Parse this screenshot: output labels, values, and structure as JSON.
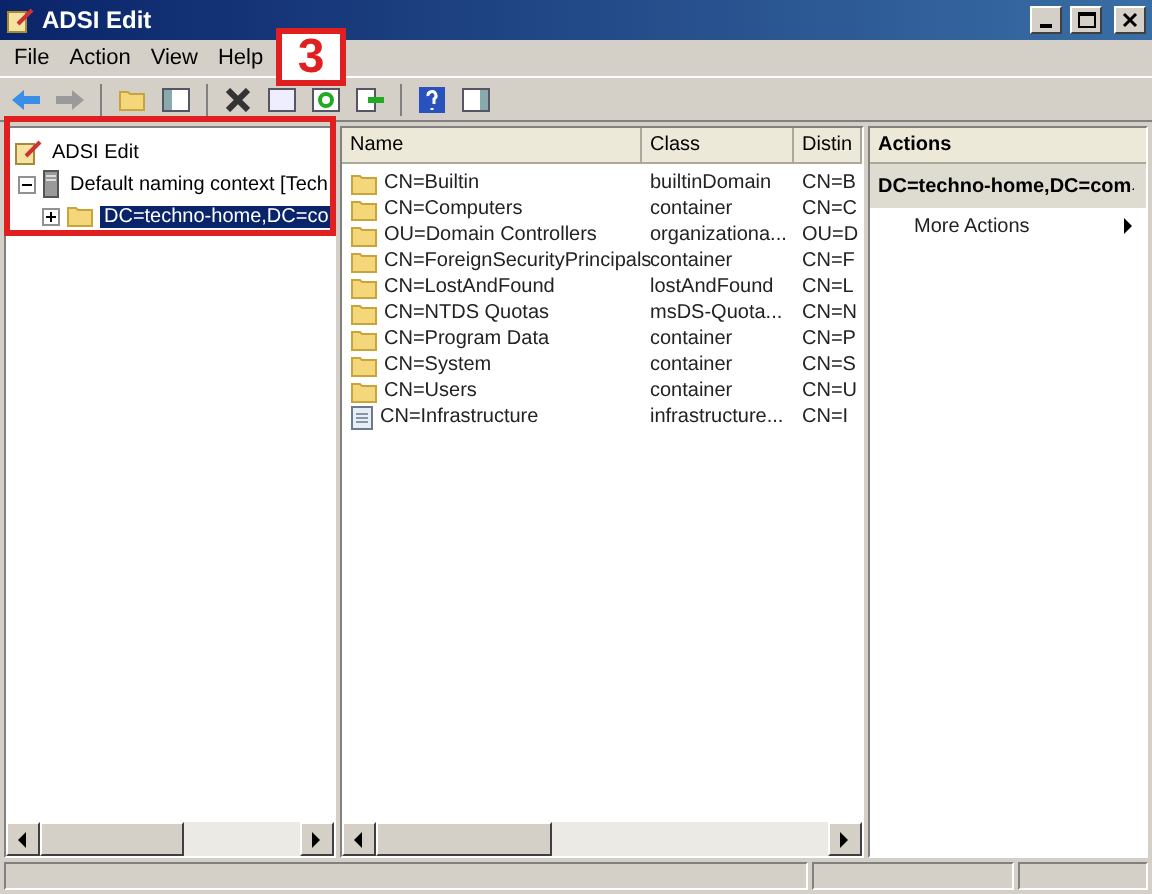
{
  "window": {
    "title": "ADSI Edit"
  },
  "menu": [
    "File",
    "Action",
    "View",
    "Help"
  ],
  "tree": [
    {
      "label": "ADSI Edit",
      "kind": "root",
      "selected": false,
      "children": [
        {
          "label": "Default naming context [Tech",
          "kind": "server",
          "expanded": true,
          "selected": false,
          "children": [
            {
              "label": "DC=techno-home,DC=co",
              "kind": "folder",
              "expanded": false,
              "selected": true
            }
          ]
        }
      ]
    }
  ],
  "annotation": {
    "label": "3"
  },
  "list": {
    "columns": [
      "Name",
      "Class",
      "Distin"
    ],
    "rows": [
      {
        "kind": "folder",
        "cells": [
          "CN=Builtin",
          "builtinDomain",
          "CN=B"
        ]
      },
      {
        "kind": "folder",
        "cells": [
          "CN=Computers",
          "container",
          "CN=C"
        ]
      },
      {
        "kind": "folder",
        "cells": [
          "OU=Domain Controllers",
          "organizationa...",
          "OU=D"
        ]
      },
      {
        "kind": "folder",
        "cells": [
          "CN=ForeignSecurityPrincipals",
          "container",
          "CN=F"
        ]
      },
      {
        "kind": "folder",
        "cells": [
          "CN=LostAndFound",
          "lostAndFound",
          "CN=L"
        ]
      },
      {
        "kind": "folder",
        "cells": [
          "CN=NTDS Quotas",
          "msDS-Quota...",
          "CN=N"
        ]
      },
      {
        "kind": "folder",
        "cells": [
          "CN=Program Data",
          "container",
          "CN=P"
        ]
      },
      {
        "kind": "folder",
        "cells": [
          "CN=System",
          "container",
          "CN=S"
        ]
      },
      {
        "kind": "folder",
        "cells": [
          "CN=Users",
          "container",
          "CN=U"
        ]
      },
      {
        "kind": "document",
        "cells": [
          "CN=Infrastructure",
          "infrastructure...",
          "CN=I"
        ]
      }
    ]
  },
  "actions": {
    "title": "Actions",
    "section": "DC=techno-home,DC=com",
    "items": [
      "More Actions"
    ]
  }
}
